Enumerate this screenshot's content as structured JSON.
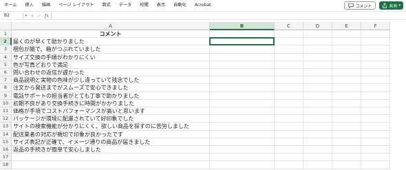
{
  "ribbon": {
    "tabs": [
      "ホーム",
      "挿入",
      "描画",
      "ページ レイアウト",
      "数式",
      "データ",
      "校閲",
      "表示",
      "自動化",
      "Acrobat"
    ],
    "comment_label": "コメント",
    "share_label": "共有",
    "share_color": "#1e7145"
  },
  "formula_bar": {
    "name_box": "B2",
    "cancel_icon": "×",
    "enter_icon": "✓",
    "fx_label": "fx",
    "value": ""
  },
  "sheet": {
    "columns": [
      "A",
      "B",
      "C",
      "D",
      "E",
      "F"
    ],
    "selected_column": "B",
    "selected_row": 2,
    "active_cell": "B2",
    "rows": [
      {
        "num": "1",
        "a": "コメント",
        "header": true
      },
      {
        "num": "2",
        "a": "届くのが早くて助かりました"
      },
      {
        "num": "3",
        "a": "梱包が雑で、箱がつぶれていました"
      },
      {
        "num": "4",
        "a": "サイズ交換の手順がわかりにくい"
      },
      {
        "num": "5",
        "a": "色が写真どおりで満足"
      },
      {
        "num": "6",
        "a": "問い合わせの返信が遅かった"
      },
      {
        "num": "7",
        "a": "商品説明と実物の色味が少し違っていて残念でした"
      },
      {
        "num": "8",
        "a": "注文から発送までがスムーズで安心できました"
      },
      {
        "num": "9",
        "a": "電話サポートの担当者がとても丁寧で助かりました"
      },
      {
        "num": "10",
        "a": "初期不良があり交換手続きに時間がかかりました"
      },
      {
        "num": "11",
        "a": "価格が手頃でコストパフォーマンスが高いと思います"
      },
      {
        "num": "12",
        "a": "パッケージが環境に配慮されていて好印象でした"
      },
      {
        "num": "13",
        "a": "サイトの検索機能が分かりにくく、欲しい商品を探すのに苦労しました"
      },
      {
        "num": "14",
        "a": "配送業者の対応が親切で印象が良かったです"
      },
      {
        "num": "15",
        "a": "サイズ表記が正確で、イメージ通りの商品が届きました"
      },
      {
        "num": "16",
        "a": "返品の手続きが簡単で安心しました"
      },
      {
        "num": "17",
        "a": ""
      },
      {
        "num": "18",
        "a": ""
      }
    ]
  }
}
